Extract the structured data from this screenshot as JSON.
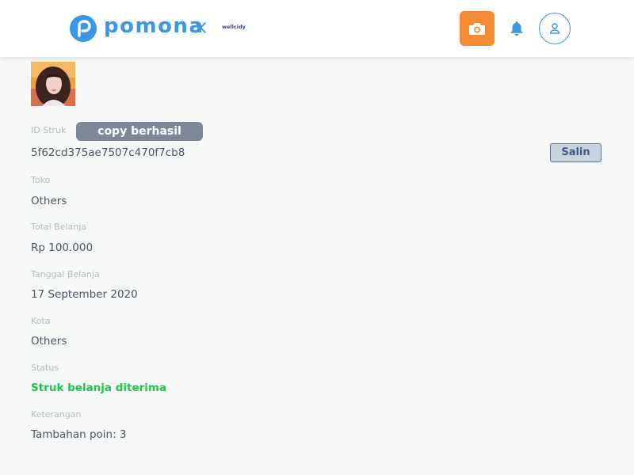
{
  "header": {
    "brand_name": "pomona",
    "partner_name": "wellcidy",
    "brand_color": "#3a97e6",
    "camera_button_color": "#f68b35"
  },
  "toast": {
    "message": "copy berhasil"
  },
  "receipt": {
    "id_label": "ID Struk",
    "id_value": "5f62cd375ae7507c470f7cb8",
    "copy_button_label": "Salin",
    "store_label": "Toko",
    "store_value": "Others",
    "total_label": "Total Belanja",
    "total_value": "Rp 100.000",
    "date_label": "Tanggal Belanja",
    "date_value": "17 September 2020",
    "city_label": "Kota",
    "city_value": "Others",
    "status_label": "Status",
    "status_value": "Struk belanja diterima",
    "status_color": "#1fc44a",
    "note_label": "Keterangan",
    "note_value": "Tambahan poin: 3"
  }
}
